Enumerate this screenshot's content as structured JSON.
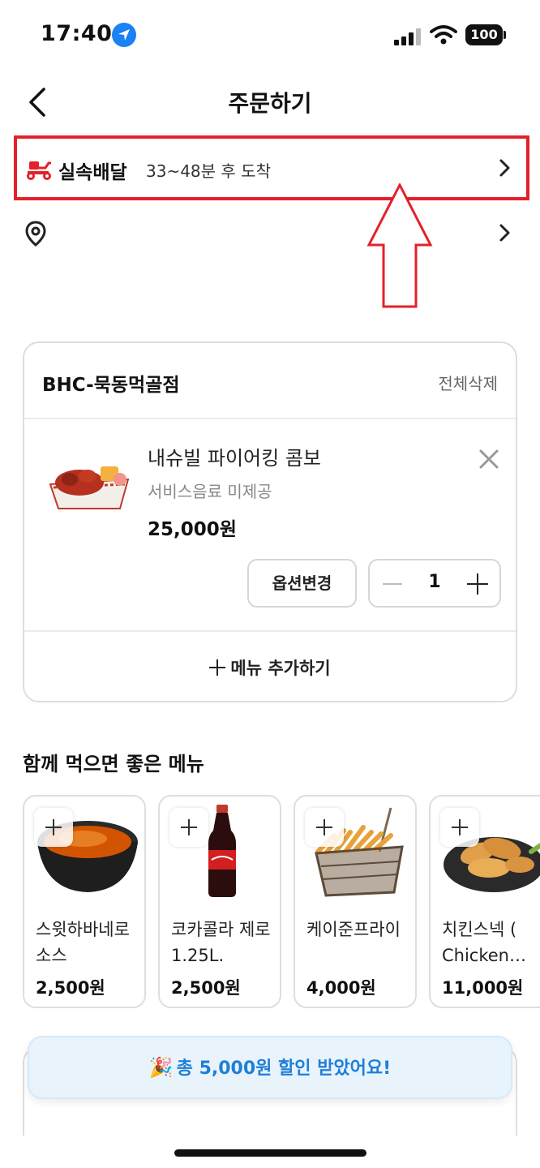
{
  "status_bar": {
    "time": "17:40",
    "battery": "100"
  },
  "header": {
    "title": "주문하기"
  },
  "delivery": {
    "type": "실속배달",
    "eta": "33~48분 후 도착"
  },
  "address": {
    "text": ""
  },
  "store": {
    "name": "BHC-묵동먹골점",
    "delete_all": "전체삭제"
  },
  "cart_item": {
    "name": "내슈빌 파이어킹 콤보",
    "option": "서비스음료 미제공",
    "price": "25,000원",
    "option_button": "옵션변경",
    "quantity": "1"
  },
  "add_menu": {
    "label": "메뉴 추가하기"
  },
  "recommendations": {
    "title": "함께 먹으면 좋은 메뉴",
    "items": [
      {
        "name": "스윗하바네로소스",
        "price": "2,500원"
      },
      {
        "name": "코카콜라 제로 1.25L.",
        "price": "2,500원"
      },
      {
        "name": "케이준프라이",
        "price": "4,000원"
      },
      {
        "name": "치킨스넥 ( Chicken…",
        "price": "11,000원"
      }
    ]
  },
  "discount_banner": {
    "text": "총 5,000원 할인 받았어요!"
  },
  "colors": {
    "highlight": "#e4202a",
    "accent_blue": "#1f7fd6",
    "delivery_icon": "#e4202a"
  }
}
